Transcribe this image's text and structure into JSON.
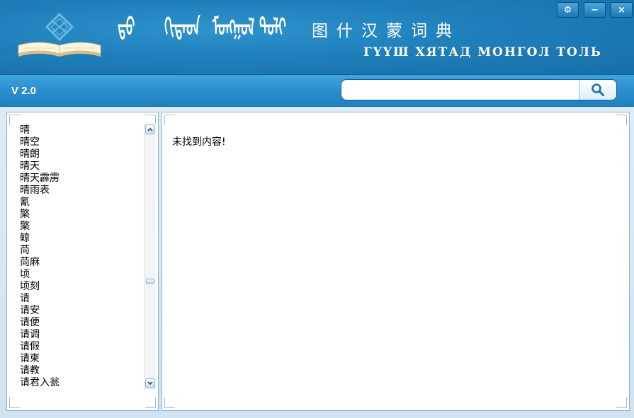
{
  "header": {
    "mongolian_title": "ᠮᠣᠩᠭᠣᠯ",
    "mongolian_glyphs": [
      "ᠳ᠋ᠥ",
      "ᠬᠢᠲᠠᠳ",
      "ᠮᠣᠩᠭᠣᠯ",
      "ᠲᠣᠯᠢ"
    ],
    "title_cn": "图什汉蒙词典",
    "title_cyrillic": "ГҮҮШ ХЯТАД МОНГОЛ ТОЛЬ"
  },
  "window_controls": {
    "settings": "⚙",
    "minimize": "−",
    "close": "×"
  },
  "toolbar": {
    "version": "V 2.0",
    "search_value": "",
    "search_placeholder": ""
  },
  "word_list": [
    "晴",
    "晴空",
    "晴朗",
    "晴天",
    "晴天霹雳",
    "晴雨表",
    "氰",
    "檠",
    "檠",
    "鲸",
    "苘",
    "苘麻",
    "顷",
    "顷刻",
    "请",
    "请安",
    "请便",
    "请调",
    "请假",
    "请柬",
    "请教",
    "请君入瓮"
  ],
  "result": {
    "message": "未找到内容!"
  },
  "colors": {
    "header_blue": "#1f7fba",
    "toolbar_blue": "#2c8fcd",
    "panel_border": "#8fb2cf"
  }
}
